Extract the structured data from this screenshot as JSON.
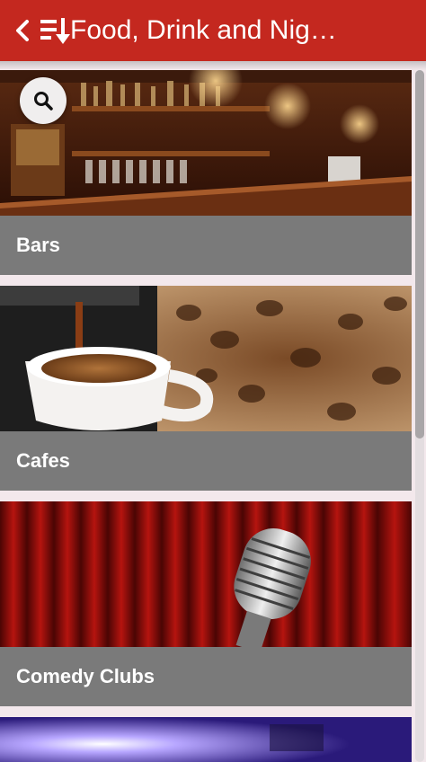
{
  "header": {
    "title": "Food, Drink and Nig…",
    "back_icon": "chevron-left-icon",
    "sort_icon": "sort-list-icon"
  },
  "search": {
    "icon": "search-icon"
  },
  "categories": [
    {
      "label": "Bars"
    },
    {
      "label": "Cafes"
    },
    {
      "label": "Comedy Clubs"
    }
  ],
  "colors": {
    "header": "#c4281f",
    "label_strip": "#7a7a7a"
  }
}
